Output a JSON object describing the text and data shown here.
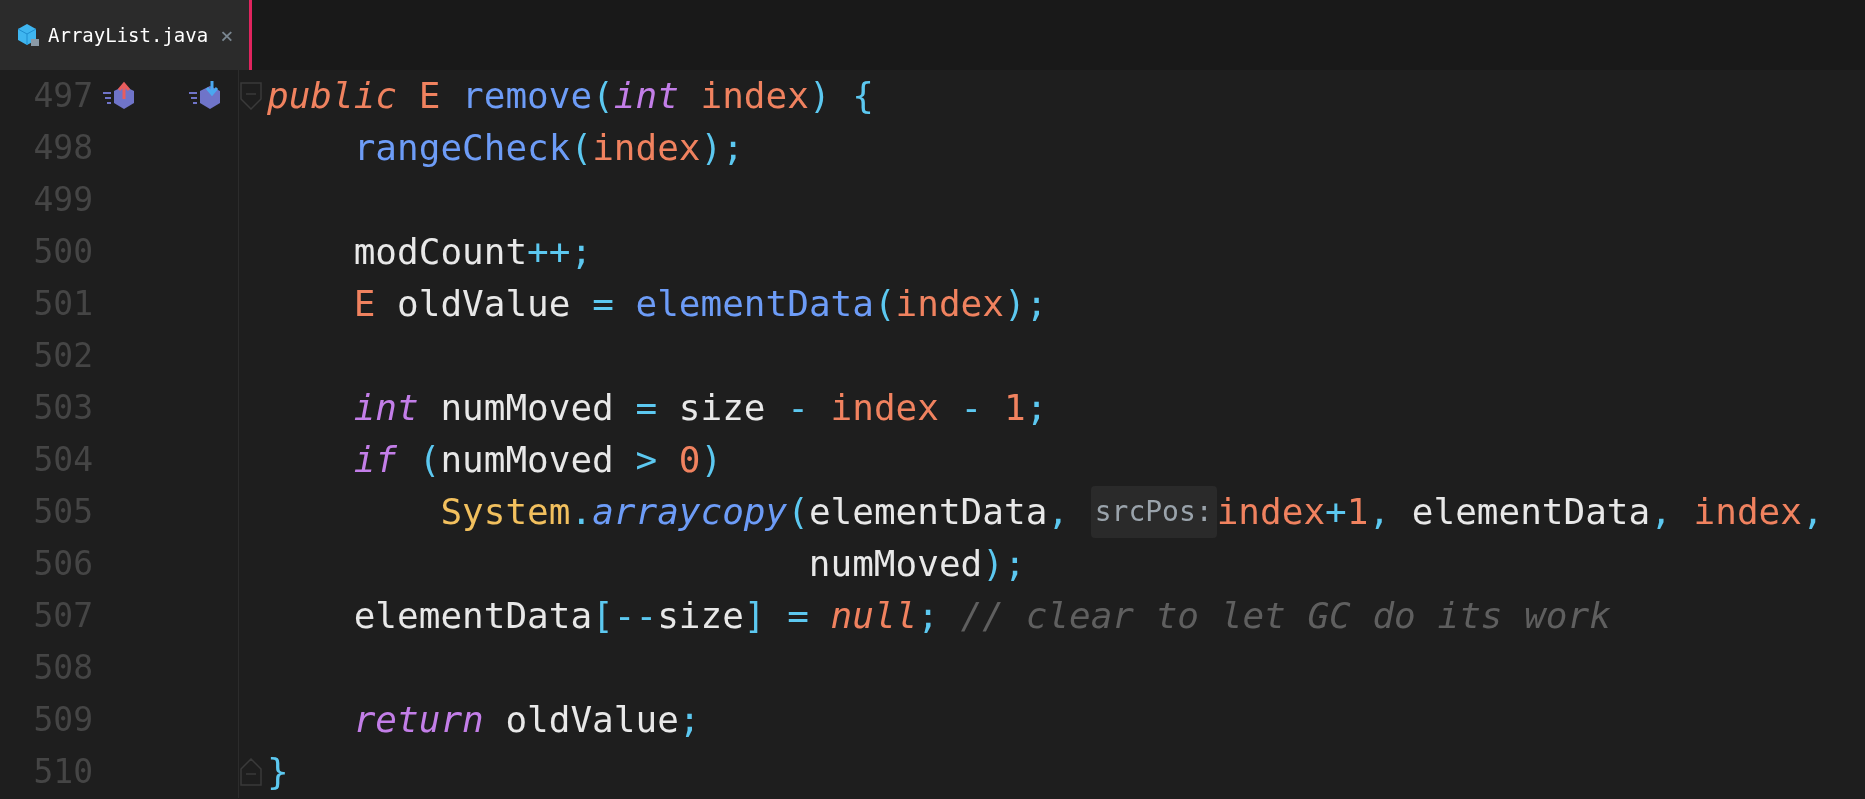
{
  "tabs": [
    {
      "label": "ArrayList.java",
      "selected": true,
      "locked": true,
      "close": "×"
    }
  ],
  "lines": [
    {
      "number": "497",
      "gutter_marks": true,
      "fold_start": true,
      "tokens": [
        {
          "kind": "modifier",
          "text": "public"
        },
        {
          "kind": "type",
          "text": " E"
        },
        {
          "kind": "method",
          "text": " remove"
        },
        {
          "kind": "punct",
          "text": "("
        },
        {
          "kind": "keyword",
          "text": "int"
        },
        {
          "kind": "param",
          "text": " index"
        },
        {
          "kind": "punct",
          "text": ")"
        },
        {
          "kind": "punct",
          "text": " {"
        }
      ]
    },
    {
      "number": "498",
      "tokens": [
        {
          "kind": "method",
          "text": "    rangeCheck"
        },
        {
          "kind": "punct",
          "text": "("
        },
        {
          "kind": "param",
          "text": "index"
        },
        {
          "kind": "punct",
          "text": ");"
        }
      ]
    },
    {
      "number": "499"
    },
    {
      "number": "500",
      "tokens": [
        {
          "kind": "plain",
          "text": "    modCount"
        },
        {
          "kind": "punct",
          "text": "++;"
        }
      ]
    },
    {
      "number": "501",
      "tokens": [
        {
          "kind": "type",
          "text": "    E"
        },
        {
          "kind": "plain",
          "text": " oldValue "
        },
        {
          "kind": "punct",
          "text": "="
        },
        {
          "kind": "method",
          "text": " elementData"
        },
        {
          "kind": "punct",
          "text": "("
        },
        {
          "kind": "param",
          "text": "index"
        },
        {
          "kind": "punct",
          "text": ");"
        }
      ]
    },
    {
      "number": "502"
    },
    {
      "number": "503",
      "tokens": [
        {
          "kind": "keyword",
          "text": "    int"
        },
        {
          "kind": "plain",
          "text": " numMoved "
        },
        {
          "kind": "punct",
          "text": "="
        },
        {
          "kind": "plain",
          "text": " size "
        },
        {
          "kind": "punct",
          "text": "-"
        },
        {
          "kind": "param",
          "text": " index"
        },
        {
          "kind": "punct",
          "text": " -"
        },
        {
          "kind": "number",
          "text": " 1"
        },
        {
          "kind": "punct",
          "text": ";"
        }
      ]
    },
    {
      "number": "504",
      "tokens": [
        {
          "kind": "keyword",
          "text": "    if"
        },
        {
          "kind": "punct",
          "text": " ("
        },
        {
          "kind": "plain",
          "text": "numMoved "
        },
        {
          "kind": "punct",
          "text": ">"
        },
        {
          "kind": "number",
          "text": " 0"
        },
        {
          "kind": "punct",
          "text": ")"
        }
      ]
    },
    {
      "number": "505",
      "tokens": [
        {
          "kind": "class",
          "text": "        System"
        },
        {
          "kind": "punct",
          "text": "."
        },
        {
          "kind": "static_method",
          "text": "arraycopy"
        },
        {
          "kind": "punct",
          "text": "("
        },
        {
          "kind": "plain",
          "text": "elementData"
        },
        {
          "kind": "punct",
          "text": ", "
        },
        {
          "kind": "hint",
          "text": "srcPos:"
        },
        {
          "kind": "param",
          "text": "index"
        },
        {
          "kind": "punct",
          "text": "+"
        },
        {
          "kind": "number",
          "text": "1"
        },
        {
          "kind": "punct",
          "text": ","
        },
        {
          "kind": "plain",
          "text": " elementData"
        },
        {
          "kind": "punct",
          "text": ","
        },
        {
          "kind": "param",
          "text": " index"
        },
        {
          "kind": "punct",
          "text": ","
        }
      ]
    },
    {
      "number": "506",
      "tokens": [
        {
          "kind": "plain",
          "text": "                         numMoved"
        },
        {
          "kind": "punct",
          "text": ");"
        }
      ]
    },
    {
      "number": "507",
      "tokens": [
        {
          "kind": "plain",
          "text": "    elementData"
        },
        {
          "kind": "punct",
          "text": "[--"
        },
        {
          "kind": "plain",
          "text": "size"
        },
        {
          "kind": "punct",
          "text": "]"
        },
        {
          "kind": "punct",
          "text": " ="
        },
        {
          "kind": "modifier",
          "text": " null"
        },
        {
          "kind": "punct",
          "text": ";"
        },
        {
          "kind": "comment",
          "text": " // clear to let GC do its work"
        }
      ]
    },
    {
      "number": "508"
    },
    {
      "number": "509",
      "tokens": [
        {
          "kind": "keyword",
          "text": "    return"
        },
        {
          "kind": "plain",
          "text": " oldValue"
        },
        {
          "kind": "punct",
          "text": ";"
        }
      ]
    },
    {
      "number": "510",
      "fold_end": true,
      "tokens": [
        {
          "kind": "punct",
          "text": "}"
        }
      ]
    }
  ]
}
